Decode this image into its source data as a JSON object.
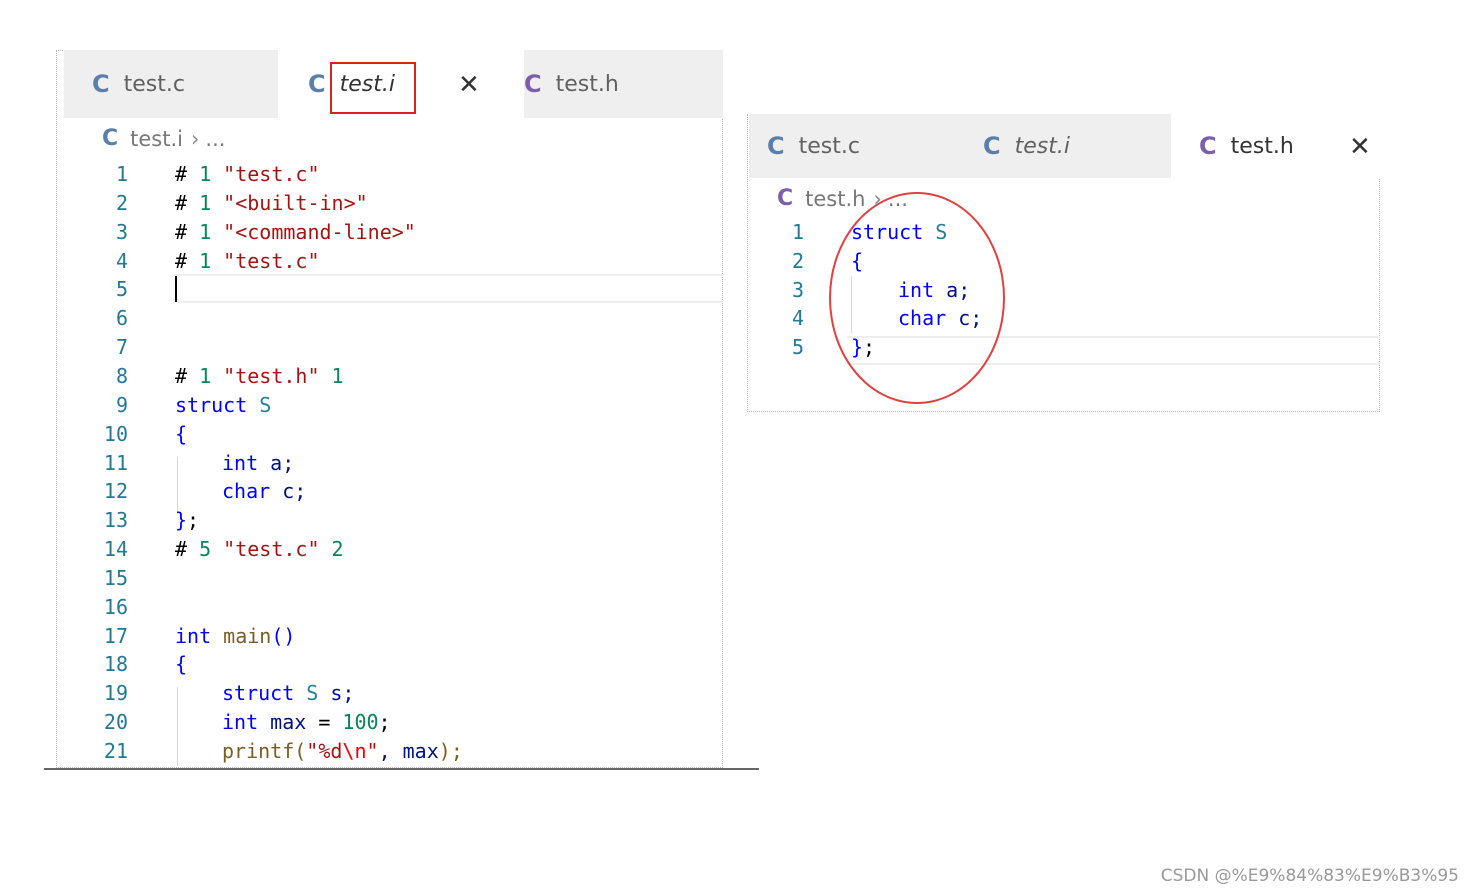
{
  "left": {
    "tabs": [
      {
        "label": "test.c",
        "icon": "C",
        "italic": false
      },
      {
        "label": "test.i",
        "icon": "C",
        "italic": true
      },
      {
        "label": "test.h",
        "icon": "C",
        "italic": false
      }
    ],
    "close_glyph": "✕",
    "breadcrumb": {
      "icon": "C",
      "file": "test.i",
      "sep": "›",
      "rest": "..."
    },
    "line_numbers": [
      "1",
      "2",
      "3",
      "4",
      "5",
      "6",
      "7",
      "8",
      "9",
      "10",
      "11",
      "12",
      "13",
      "14",
      "15",
      "16",
      "17",
      "18",
      "19",
      "20",
      "21"
    ]
  },
  "right": {
    "tabs": [
      {
        "label": "test.c",
        "icon": "C",
        "italic": false
      },
      {
        "label": "test.i",
        "icon": "C",
        "italic": true
      },
      {
        "label": "test.h",
        "icon": "C",
        "italic": false
      }
    ],
    "close_glyph": "✕",
    "breadcrumb": {
      "icon": "C",
      "file": "test.h",
      "sep": "›",
      "rest": "..."
    },
    "line_numbers": [
      "1",
      "2",
      "3",
      "4",
      "5"
    ]
  },
  "code_left": {
    "l1": [
      "#",
      " 1 ",
      "\"test.c\""
    ],
    "l2": [
      "#",
      " 1 ",
      "\"<built-in>\""
    ],
    "l3": [
      "#",
      " 1 ",
      "\"<command-line>\""
    ],
    "l4": [
      "#",
      " 1 ",
      "\"test.c\""
    ],
    "l8": [
      "#",
      " 1 ",
      "\"test.h\"",
      " 1"
    ],
    "l9": [
      "struct",
      " S"
    ],
    "l10": [
      "{"
    ],
    "l11": [
      "int",
      " a;"
    ],
    "l12": [
      "char",
      " c;"
    ],
    "l13": [
      "}",
      ";"
    ],
    "l14": [
      "#",
      " 5 ",
      "\"test.c\"",
      " 2"
    ],
    "l17": [
      "int",
      " main",
      "()"
    ],
    "l18": [
      "{"
    ],
    "l19": [
      "struct",
      " S",
      " s;"
    ],
    "l20": [
      "int",
      " max",
      " = ",
      "100",
      ";"
    ],
    "l21": [
      "printf",
      "(",
      "\"%d",
      "\\n",
      "\"",
      ", max",
      ");"
    ]
  },
  "code_right": {
    "l1": [
      "struct",
      " S"
    ],
    "l2": [
      "{"
    ],
    "l3": [
      "int",
      " a;"
    ],
    "l4": [
      "char",
      " c;"
    ],
    "l5": [
      "}",
      ";"
    ]
  },
  "watermark": "CSDN @%E9%84%83%E9%B3%95"
}
